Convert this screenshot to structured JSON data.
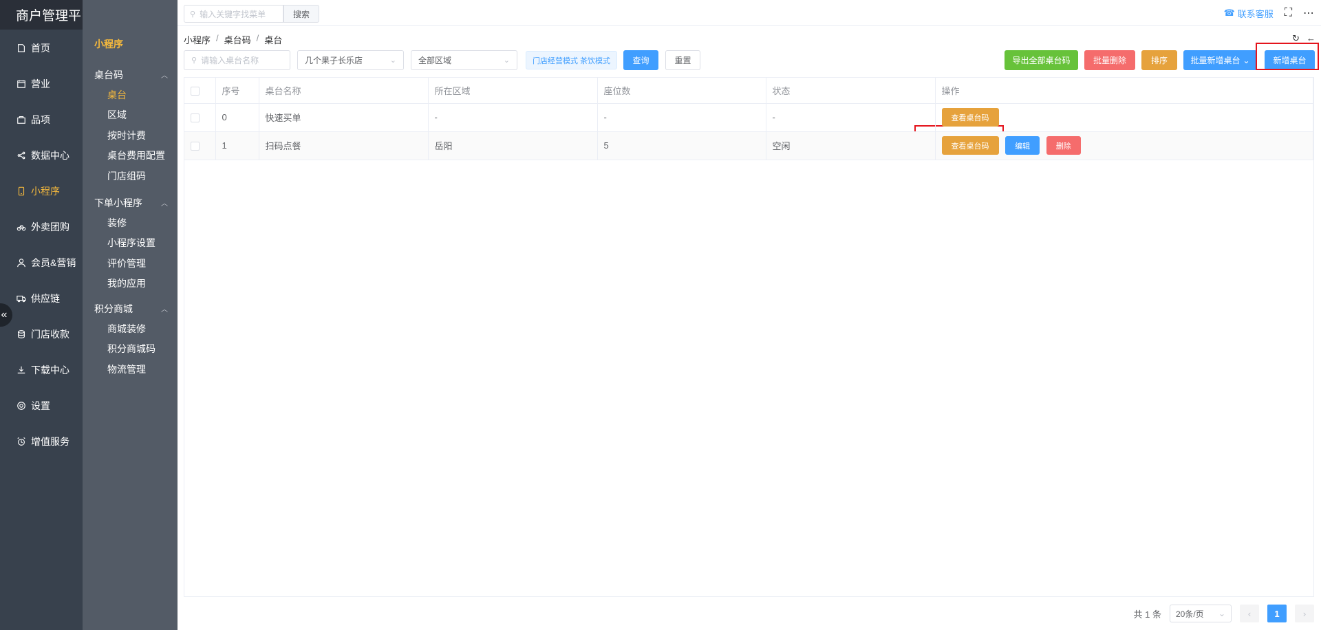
{
  "app": {
    "title": "商户管理平台"
  },
  "main_nav": [
    {
      "label": "首页",
      "icon": "home-icon"
    },
    {
      "label": "营业",
      "icon": "calendar-icon"
    },
    {
      "label": "品项",
      "icon": "bag-icon"
    },
    {
      "label": "数据中心",
      "icon": "share-icon"
    },
    {
      "label": "小程序",
      "icon": "phone-icon",
      "active": true
    },
    {
      "label": "外卖团购",
      "icon": "bike-icon"
    },
    {
      "label": "会员&营销",
      "icon": "user-icon"
    },
    {
      "label": "供应链",
      "icon": "truck-icon"
    },
    {
      "label": "门店收款",
      "icon": "coins-icon"
    },
    {
      "label": "下载中心",
      "icon": "download-icon"
    },
    {
      "label": "设置",
      "icon": "gear-icon"
    },
    {
      "label": "增值服务",
      "icon": "alarm-icon"
    }
  ],
  "sub_nav": {
    "title": "小程序",
    "groups": [
      {
        "label": "桌台码",
        "items": [
          "桌台",
          "区域",
          "按时计费",
          "桌台费用配置",
          "门店组码"
        ]
      },
      {
        "label": "下单小程序",
        "items": [
          "装修",
          "小程序设置",
          "评价管理",
          "我的应用"
        ]
      },
      {
        "label": "积分商城",
        "items": [
          "商城装修",
          "积分商城码",
          "物流管理"
        ]
      }
    ]
  },
  "topbar": {
    "search_placeholder": "输入关键字找菜单",
    "search_button": "搜索",
    "service_label": "联系客服"
  },
  "breadcrumb": [
    "小程序",
    "桌台码",
    "桌台"
  ],
  "filters": {
    "name_placeholder": "请输入桌台名称",
    "store": "几个果子长乐店",
    "area": "全部区域",
    "mode_tag": "门店经营模式 茶饮模式",
    "query": "查询",
    "reset": "重置"
  },
  "actions": {
    "export": "导出全部桌台码",
    "batch_delete": "批量删除",
    "sort": "排序",
    "batch_add": "批量新增桌台",
    "add": "新增桌台"
  },
  "table": {
    "columns": [
      "序号",
      "桌台名称",
      "所在区域",
      "座位数",
      "状态",
      "操作"
    ],
    "rows": [
      {
        "index": "0",
        "name": "快速买单",
        "area": "-",
        "seats": "-",
        "status": "-"
      },
      {
        "index": "1",
        "name": "扫码点餐",
        "area": "岳阳",
        "seats": "5",
        "status": "空闲"
      }
    ],
    "row_actions": {
      "view_code": "查看桌台码",
      "edit": "编辑",
      "delete": "删除"
    }
  },
  "pagination": {
    "total": "共 1 条",
    "page_size": "20条/页",
    "current": "1"
  }
}
